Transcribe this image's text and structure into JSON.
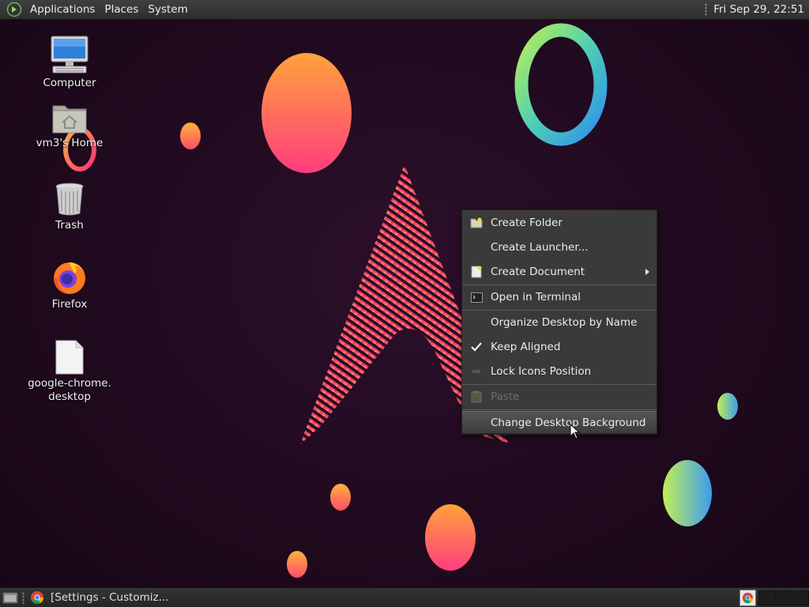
{
  "top_panel": {
    "menus": [
      "Applications",
      "Places",
      "System"
    ],
    "clock": "Fri Sep 29, 22:51"
  },
  "desktop": {
    "icons": [
      {
        "label": "Computer",
        "icon": "computer-icon"
      },
      {
        "label": "vm3's Home",
        "icon": "home-folder-icon"
      },
      {
        "label": "Trash",
        "icon": "trash-icon"
      },
      {
        "label": "Firefox",
        "icon": "firefox-icon"
      },
      {
        "label": "google-chrome.\ndesktop",
        "icon": "document-icon"
      }
    ]
  },
  "context_menu": {
    "items": [
      {
        "label": "Create Folder",
        "icon": "folder-new-icon"
      },
      {
        "label": "Create Launcher...",
        "icon": ""
      },
      {
        "label": "Create Document",
        "icon": "document-new-icon",
        "submenu": true
      },
      {
        "label": "Open in Terminal",
        "icon": "terminal-icon"
      },
      {
        "label": "Organize Desktop by Name",
        "icon": ""
      },
      {
        "label": "Keep Aligned",
        "icon": "check-icon",
        "checked": true
      },
      {
        "label": "Lock Icons Position",
        "icon": "lock-toggle-icon"
      },
      {
        "label": "Paste",
        "icon": "paste-icon",
        "disabled": true
      },
      {
        "label": "Change Desktop Background",
        "icon": "",
        "highlighted": true
      }
    ]
  },
  "bottom_panel": {
    "taskbar_item": "[Settings - Customiz..."
  },
  "colors": {
    "panel": "#333333",
    "menu_bg": "#3a3a3a",
    "wallpaper_bg": "#200a1f",
    "accent_pink": "#e8336e",
    "accent_orange": "#ff9a3c"
  }
}
